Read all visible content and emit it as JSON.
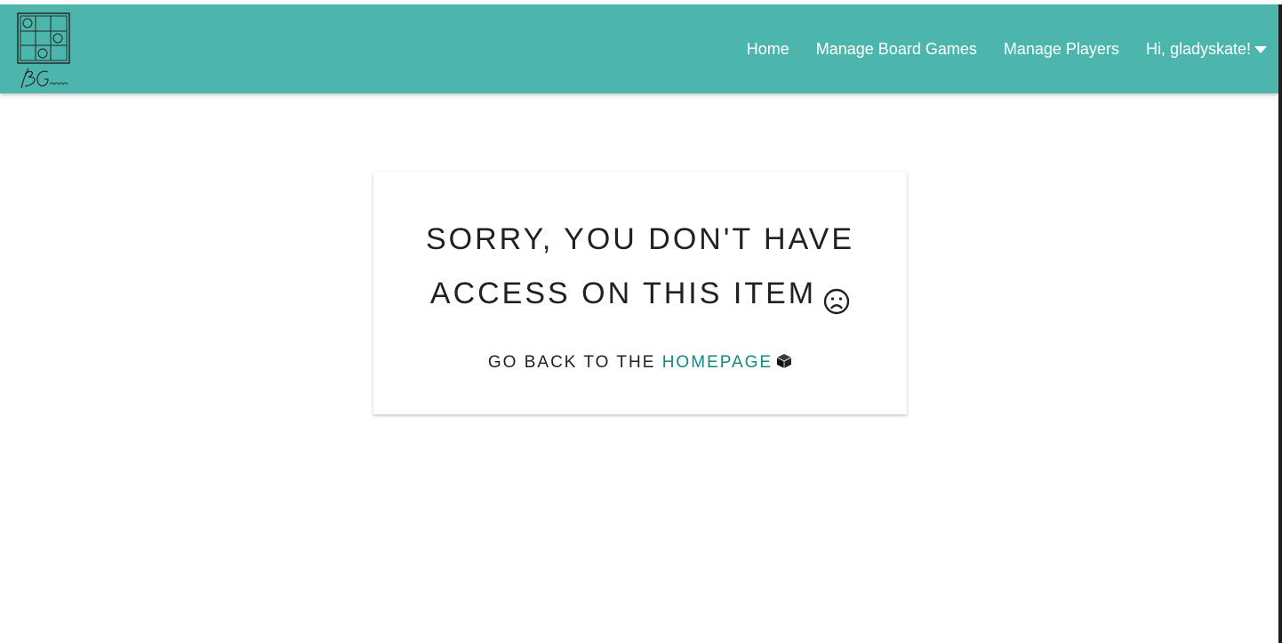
{
  "navbar": {
    "background": "#4db6ac",
    "logo_icon": "board-games-logo-icon",
    "links": {
      "home": "Home",
      "manage_board_games": "Manage Board Games",
      "manage_players": "Manage Players",
      "user_greeting": "Hi, gladyskate!"
    },
    "user_menu_icon": "caret-down-icon"
  },
  "message": {
    "title_line1": "SORRY, YOU DON'T HAVE",
    "title_line2": "ACCESS ON THIS ITEM",
    "title_icon": "sad-face-icon",
    "back_prefix": "GO BACK TO THE",
    "back_link": "HOMEPAGE",
    "back_icon": "cube-icon",
    "link_color": "#0f8a80"
  }
}
